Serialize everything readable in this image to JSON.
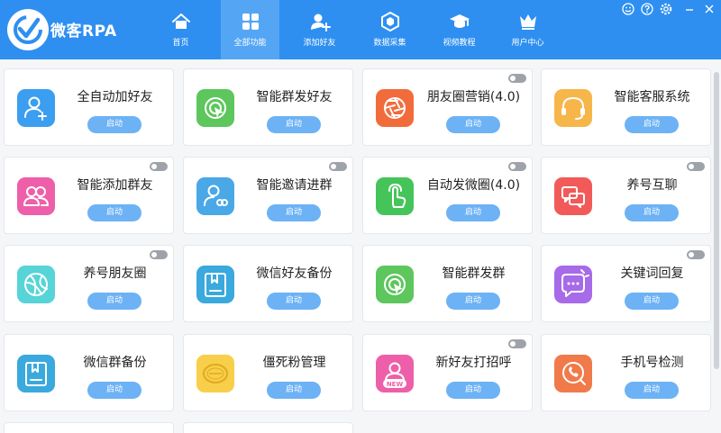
{
  "app": {
    "title": "微客RPA"
  },
  "nav": {
    "tabs": [
      {
        "label": "首页",
        "icon": "home-icon"
      },
      {
        "label": "全部功能",
        "icon": "grid-icon",
        "active": true
      },
      {
        "label": "添加好友",
        "icon": "add-user-icon"
      },
      {
        "label": "数据采集",
        "icon": "cube-icon"
      },
      {
        "label": "视频教程",
        "icon": "graduation-cap-icon"
      },
      {
        "label": "用户中心",
        "icon": "crown-icon"
      }
    ]
  },
  "window_controls": [
    "support-icon",
    "help-icon",
    "settings-icon",
    "minimize-icon",
    "close-icon"
  ],
  "start_label": "启动",
  "cards": [
    {
      "title": "全自动加好友",
      "icon": "add-user-icon",
      "color": "#3b9ef0",
      "toggle": false
    },
    {
      "title": "智能群发好友",
      "icon": "broadcast-cursor-icon",
      "color": "#5dc65d",
      "toggle": false
    },
    {
      "title": "朋友圈营销(4.0)",
      "icon": "camera-shutter-icon",
      "color": "#f26c3b",
      "toggle": true
    },
    {
      "title": "智能客服系统",
      "icon": "headset-icon",
      "color": "#f7b64a",
      "toggle": false
    },
    {
      "title": "智能添加群友",
      "icon": "group-users-icon",
      "color": "#ee5fa9",
      "toggle": true
    },
    {
      "title": "智能邀请进群",
      "icon": "invite-user-icon",
      "color": "#4aa8e6",
      "toggle": true
    },
    {
      "title": "自动发微圈(4.0)",
      "icon": "tap-hand-icon",
      "color": "#45c45a",
      "toggle": true
    },
    {
      "title": "养号互聊",
      "icon": "chat-bubbles-icon",
      "color": "#f25a5a",
      "toggle": true
    },
    {
      "title": "养号朋友圈",
      "icon": "moments-shutter-icon",
      "color": "#56d4d8",
      "toggle": true
    },
    {
      "title": "微信好友备份",
      "icon": "backup-bookmark-icon",
      "color": "#3aa9dd",
      "toggle": false
    },
    {
      "title": "智能群发群",
      "icon": "broadcast-cursor-icon",
      "color": "#5dc65d",
      "toggle": false
    },
    {
      "title": "关键词回复",
      "icon": "chat-reply-icon",
      "color": "#a76ae8",
      "toggle": true
    },
    {
      "title": "微信群备份",
      "icon": "backup-bookmark-icon",
      "color": "#3aa9dd",
      "toggle": false
    },
    {
      "title": "僵死粉管理",
      "icon": "zombie-stamp-icon",
      "color": "#f8cf4a",
      "toggle": false
    },
    {
      "title": "新好友打招呼",
      "icon": "new-user-icon",
      "color": "#ee5fa9",
      "toggle": true
    },
    {
      "title": "手机号检测",
      "icon": "phone-search-icon",
      "color": "#f07a4a",
      "toggle": false
    }
  ]
}
